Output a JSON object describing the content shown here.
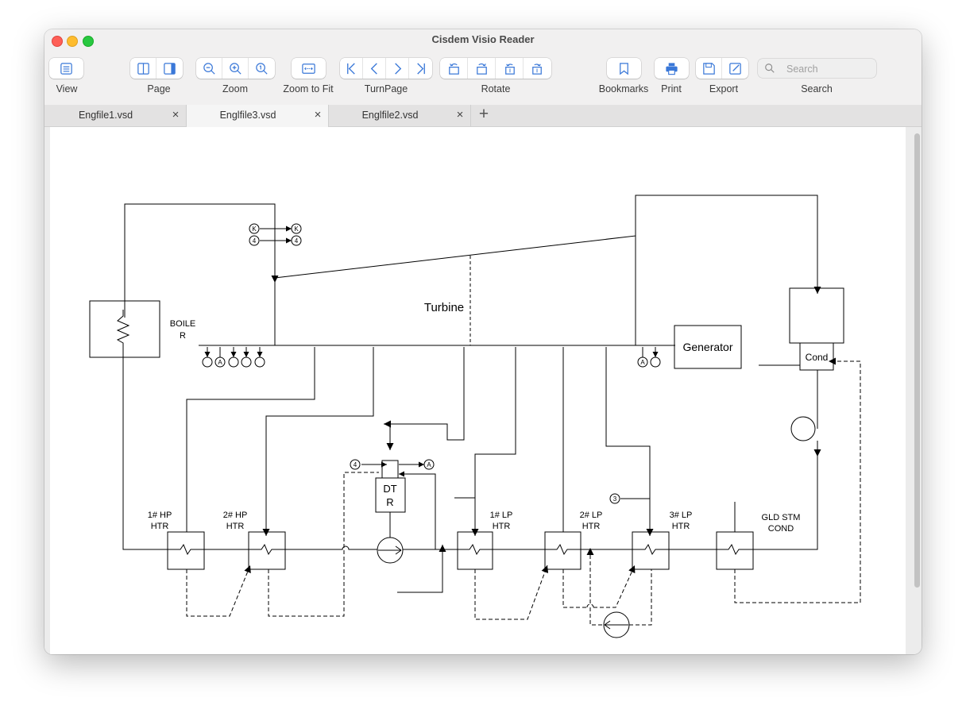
{
  "app": {
    "title": "Cisdem Visio Reader"
  },
  "toolbar": {
    "view_label": "View",
    "page_label": "Page",
    "zoom_label": "Zoom",
    "zoom_to_fit_label": "Zoom to Fit",
    "turnpage_label": "TurnPage",
    "rotate_label": "Rotate",
    "bookmarks_label": "Bookmarks",
    "print_label": "Print",
    "export_label": "Export",
    "search_label": "Search",
    "search_placeholder": "Search"
  },
  "tabs": [
    {
      "label": "Engfile1.vsd",
      "active": false
    },
    {
      "label": "Englfile3.vsd",
      "active": true
    },
    {
      "label": "Englfile2.vsd",
      "active": false
    }
  ],
  "diagram": {
    "turbine": "Turbine",
    "boiler_line1": "BOILE",
    "boiler_line2": "R",
    "generator": "Generator",
    "cond": "Cond",
    "dtr_line1": "DT",
    "dtr_line2": "R",
    "htr1": [
      "1# HP",
      "HTR"
    ],
    "htr2": [
      "2# HP",
      "HTR"
    ],
    "lp1": [
      "1# LP",
      "HTR"
    ],
    "lp2": [
      "2# LP",
      "HTR"
    ],
    "lp3": [
      "3# LP",
      "HTR"
    ],
    "gld": [
      "GLD STM",
      "COND"
    ],
    "marker_k": "K",
    "marker_4": "4",
    "marker_a": "A",
    "marker_3": "3"
  }
}
